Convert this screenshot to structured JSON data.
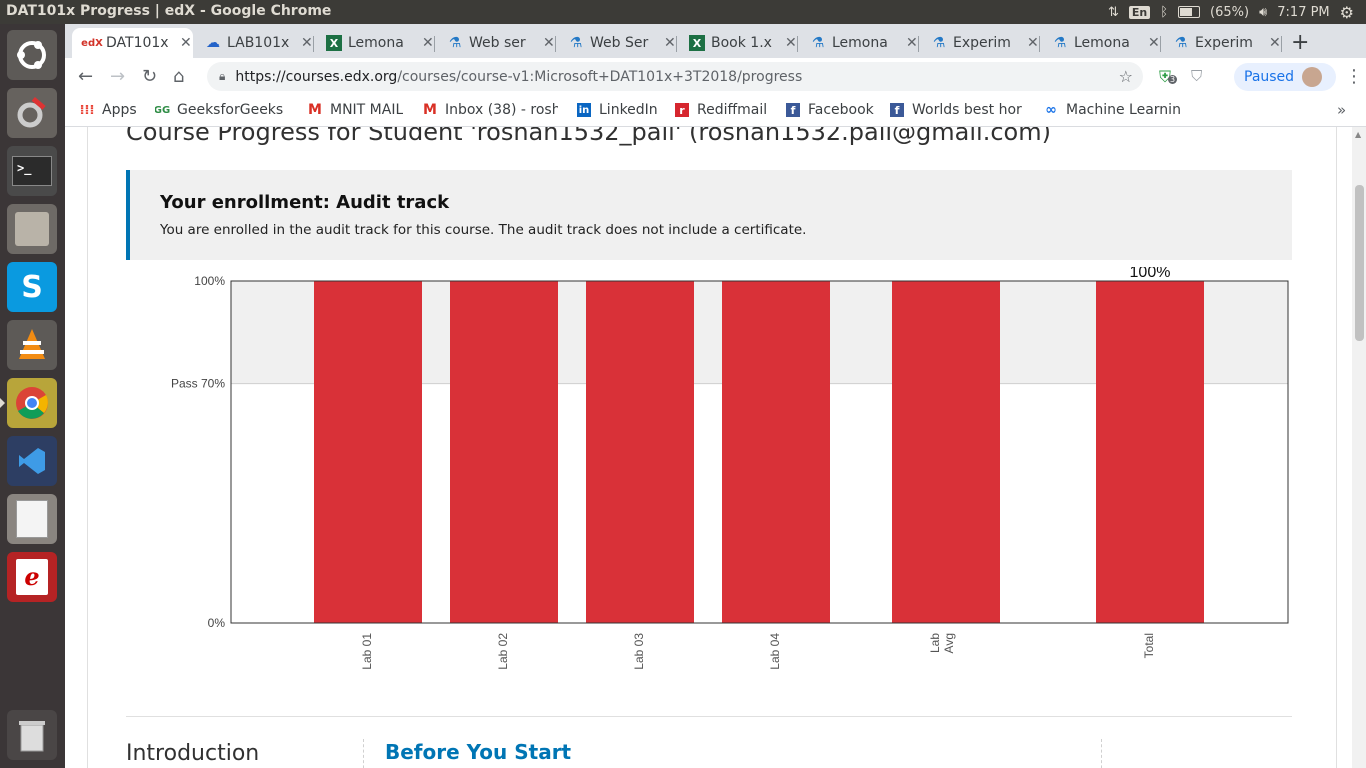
{
  "window": {
    "title": "DAT101x Progress | edX - Google Chrome",
    "language": "En",
    "battery": "(65%)",
    "time": "7:17 PM"
  },
  "tabs": [
    {
      "label": "DAT101x",
      "icon": "edx-icon",
      "active": true
    },
    {
      "label": "LAB101x",
      "icon": "cloud-icon"
    },
    {
      "label": "Lemona",
      "icon": "excel-icon"
    },
    {
      "label": "Web ser",
      "icon": "flask-icon"
    },
    {
      "label": "Web Ser",
      "icon": "flask-icon"
    },
    {
      "label": "Book 1.x",
      "icon": "excel-icon"
    },
    {
      "label": "Lemona",
      "icon": "flask-icon"
    },
    {
      "label": "Experim",
      "icon": "flask-icon"
    },
    {
      "label": "Lemona",
      "icon": "flask-icon"
    },
    {
      "label": "Experim",
      "icon": "flask-icon"
    }
  ],
  "address": {
    "host": "https://courses.edx.org",
    "path": "/courses/course-v1:Microsoft+DAT101x+3T2018/progress"
  },
  "profile": {
    "label": "Paused",
    "extension_badge": "3"
  },
  "bookmarks": [
    {
      "label": "Apps",
      "icon": "apps-grid-icon"
    },
    {
      "label": "GeeksforGeeks |",
      "icon": "geeksforgeeks-icon"
    },
    {
      "label": "MNIT MAIL",
      "icon": "gmail-icon"
    },
    {
      "label": "Inbox (38) - rosh",
      "icon": "gmail-icon"
    },
    {
      "label": "LinkedIn",
      "icon": "linkedin-icon"
    },
    {
      "label": "Rediffmail",
      "icon": "rediffmail-icon"
    },
    {
      "label": "Facebook",
      "icon": "facebook-icon"
    },
    {
      "label": "Worlds best hor",
      "icon": "facebook-icon"
    },
    {
      "label": "Machine Learnin",
      "icon": "ml-infinity-icon"
    }
  ],
  "page": {
    "heading": "Course Progress for Student 'roshan1532_pali' (roshan1532.pali@gmail.com)",
    "enrollment_title": "Your enrollment: Audit track",
    "enrollment_text": "You are enrolled in the audit track for this course. The audit track does not include a certificate.",
    "section_title": "Introduction",
    "subsection_title": "Before You Start"
  },
  "colors": {
    "bar": "#d93138",
    "pass_band": "#f0f0f0",
    "accent": "#0075b4"
  },
  "chart_data": {
    "type": "bar",
    "categories": [
      "Lab 01",
      "Lab 02",
      "Lab 03",
      "Lab 04",
      "Lab Avg",
      "Total"
    ],
    "values": [
      100,
      100,
      100,
      100,
      100,
      100
    ],
    "ylim": [
      0,
      100
    ],
    "yticks": [
      {
        "value": 0,
        "label": "0%"
      },
      {
        "value": 70,
        "label": "Pass 70%"
      },
      {
        "value": 100,
        "label": "100%"
      }
    ],
    "pass_threshold": 70,
    "total_label": "100%"
  }
}
